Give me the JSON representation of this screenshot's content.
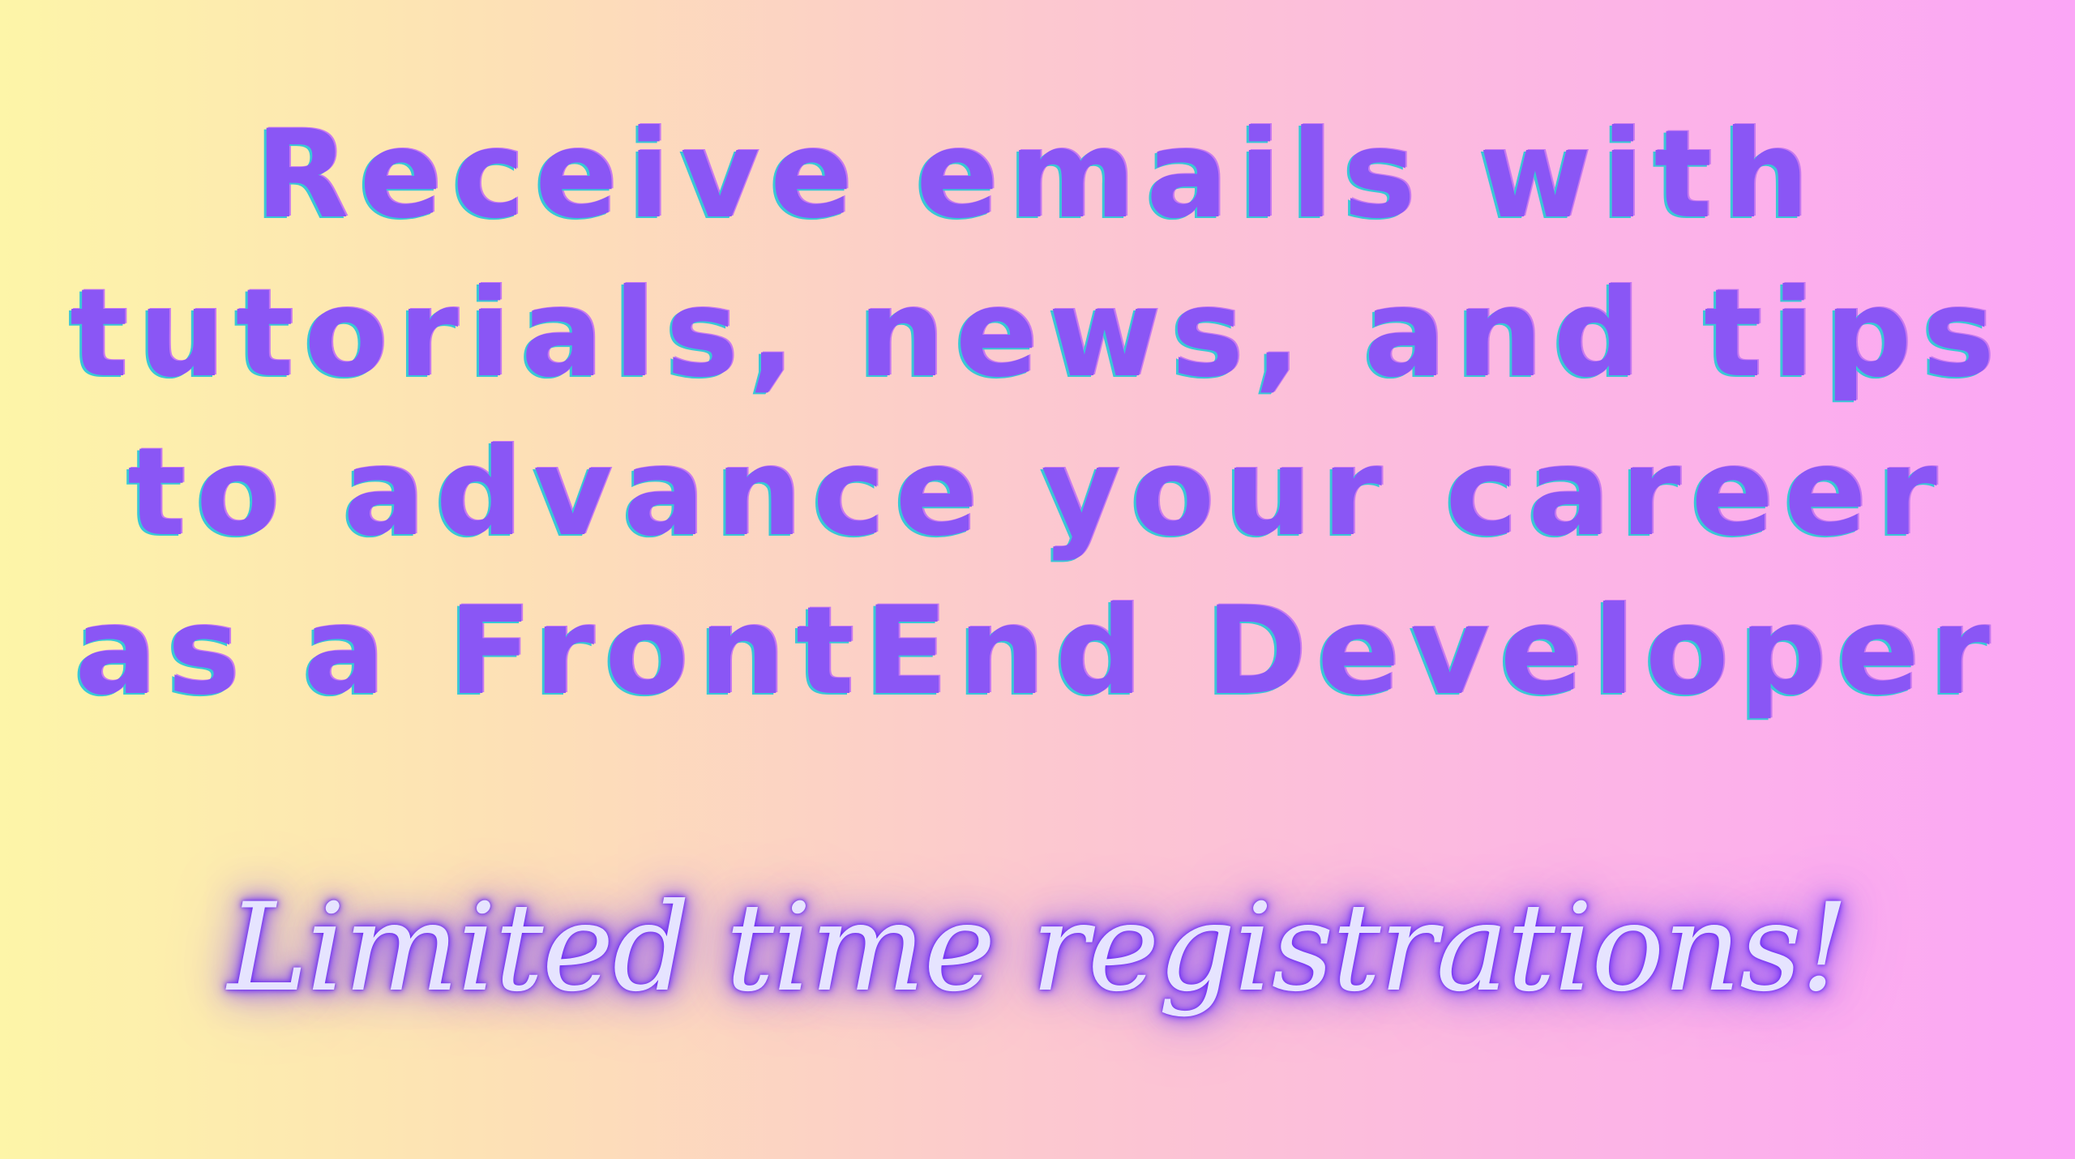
{
  "headline": {
    "lines": [
      "Receive emails with",
      "tutorials, news, and tips",
      "to advance your career",
      "as a FrontEnd Developer"
    ]
  },
  "tagline": "Limited time registrations!",
  "colors": {
    "headline_text": "#8a56f5",
    "headline_shadow": "#39c7d6",
    "tagline_text": "#e6e4ff",
    "tagline_glow": "#6b2cf5",
    "gradient_left": "#fdf5a8",
    "gradient_right": "#fba6f6"
  }
}
